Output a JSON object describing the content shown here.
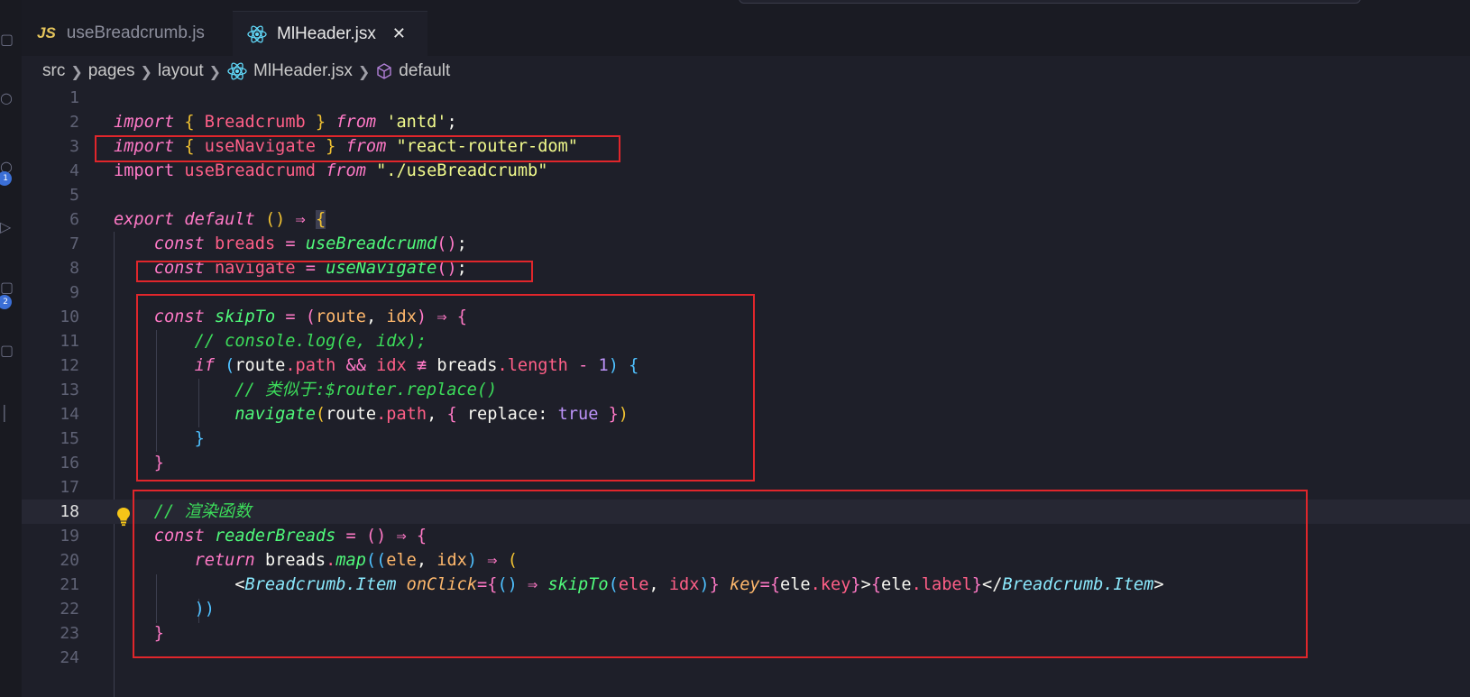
{
  "tabs": [
    {
      "icon": "JS",
      "label": "useBreadcrumb.js",
      "active": false
    },
    {
      "label": "MlHeader.jsx",
      "active": true,
      "close_glyph": "✕"
    }
  ],
  "breadcrumb": [
    "src",
    "pages",
    "layout",
    "MlHeader.jsx",
    "default"
  ],
  "activity_badges": [
    "1",
    "2"
  ],
  "editor": {
    "active_line": 18,
    "lines": [
      {
        "n": "1"
      },
      {
        "n": "2"
      },
      {
        "n": "3"
      },
      {
        "n": "4"
      },
      {
        "n": "5"
      },
      {
        "n": "6"
      },
      {
        "n": "7"
      },
      {
        "n": "8"
      },
      {
        "n": "9"
      },
      {
        "n": "10"
      },
      {
        "n": "11"
      },
      {
        "n": "12"
      },
      {
        "n": "13"
      },
      {
        "n": "14"
      },
      {
        "n": "15"
      },
      {
        "n": "16"
      },
      {
        "n": "17"
      },
      {
        "n": "18"
      },
      {
        "n": "19"
      },
      {
        "n": "20"
      },
      {
        "n": "21"
      },
      {
        "n": "22"
      },
      {
        "n": "23"
      },
      {
        "n": "24"
      }
    ],
    "code": {
      "l2_import": "import",
      "l2_open": "{ ",
      "l2_name": "Breadcrumb",
      "l2_close": " }",
      "l2_from": "from",
      "l2_mod": "'antd'",
      "l2_semi": ";",
      "l3_import": "import",
      "l3_open": "{ ",
      "l3_name": "useNavigate",
      "l3_close": " }",
      "l3_from": "from",
      "l3_mod": "\"react-router-dom\"",
      "l4_import": "import",
      "l4_name": "useBreadcrumd",
      "l4_from": "from",
      "l4_mod": "\"./useBreadcrumb\"",
      "l6_export": "export",
      "l6_default": "default",
      "l6_parens": "()",
      "l6_arrow": "⇒",
      "l6_brace": "{",
      "l7_const": "const",
      "l7_var": "breads",
      "l7_eq": "=",
      "l7_fn": "useBreadcrumd",
      "l7_call": "()",
      "l7_semi": ";",
      "l8_const": "const",
      "l8_var": "navigate",
      "l8_eq": "=",
      "l8_fn": "useNavigate",
      "l8_call": "()",
      "l8_semi": ";",
      "l10_const": "const",
      "l10_fn": "skipTo",
      "l10_eq": "=",
      "l10_po": "(",
      "l10_p1": "route",
      "l10_comma": ", ",
      "l10_p2": "idx",
      "l10_pc": ")",
      "l10_arrow": "⇒",
      "l10_brace": "{",
      "l11_comment": "// console.log(e, idx);",
      "l12_if": "if",
      "l12_po": "(",
      "l12_obj": "route",
      "l12_dot": ".",
      "l12_prop": "path",
      "l12_and": "&&",
      "l12_idx": "idx",
      "l12_neq": "≢",
      "l12_breads": "breads",
      "l12_dot2": ".",
      "l12_len": "length",
      "l12_minus": "-",
      "l12_num": "1",
      "l12_pc": ")",
      "l12_brace": "{",
      "l13_comment_a": "// 类似于:",
      "l13_comment_b": "$router.replace()",
      "l14_fn": "navigate",
      "l14_po": "(",
      "l14_obj": "route",
      "l14_dot": ".",
      "l14_prop": "path",
      "l14_comma": ", ",
      "l14_bo": "{",
      "l14_key": " replace: ",
      "l14_val": "true",
      "l14_bc": " }",
      "l14_pc": ")",
      "l15_brace": "}",
      "l16_brace": "}",
      "l18_comment": "// 渲染函数",
      "l19_const": "const",
      "l19_fn": "readerBreads",
      "l19_eq": "=",
      "l19_parens": "()",
      "l19_arrow": "⇒",
      "l19_brace": "{",
      "l20_return": "return",
      "l20_obj": "breads",
      "l20_dot": ".",
      "l20_fn": "map",
      "l20_po": "((",
      "l20_p1": "ele",
      "l20_comma": ", ",
      "l20_p2": "idx",
      "l20_pc": ")",
      "l20_arrow": "⇒",
      "l20_open": "(",
      "l21_lt": "<",
      "l21_tag": "Breadcrumb.Item",
      "l21_attr1": "onClick",
      "l21_eq1": "=",
      "l21_b1": "{",
      "l21_parens": "()",
      "l21_arrow": "⇒",
      "l21_fn": "skipTo",
      "l21_po": "(",
      "l21_a1": "ele",
      "l21_comma": ", ",
      "l21_a2": "idx",
      "l21_pc": ")",
      "l21_b1c": "}",
      "l21_attr2": "key",
      "l21_eq2": "=",
      "l21_b2": "{",
      "l21_ele": "ele",
      "l21_dot": ".",
      "l21_key": "key",
      "l21_b2c": "}",
      "l21_gt": ">",
      "l21_b3": "{",
      "l21_ele2": "ele",
      "l21_dot2": ".",
      "l21_label": "label",
      "l21_b3c": "}",
      "l21_close": "</",
      "l21_tag2": "Breadcrumb.Item",
      "l21_gt2": ">",
      "l22_close": "))",
      "l23_brace": "}"
    }
  },
  "colors": {
    "highlight_box": "#e0262b",
    "background": "#1e1f29"
  }
}
